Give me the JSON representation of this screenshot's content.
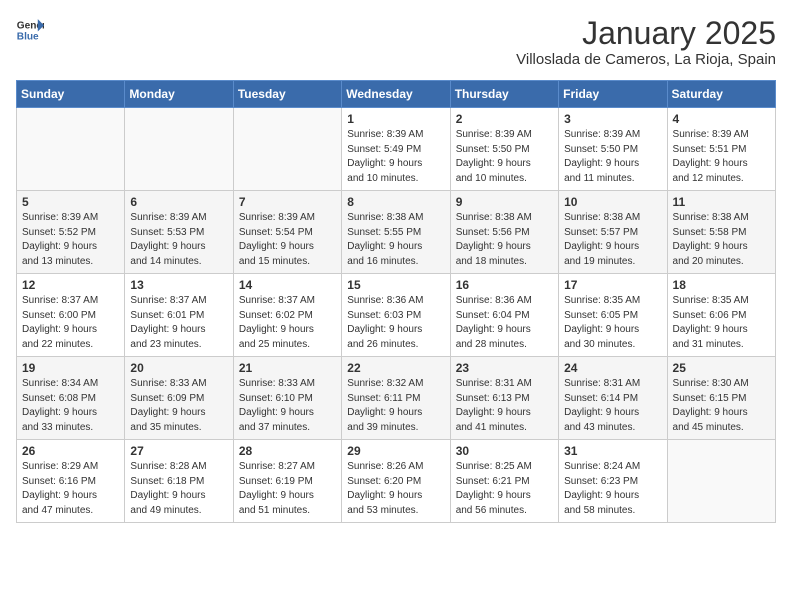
{
  "logo": {
    "general": "General",
    "blue": "Blue"
  },
  "header": {
    "month": "January 2025",
    "location": "Villoslada de Cameros, La Rioja, Spain"
  },
  "weekdays": [
    "Sunday",
    "Monday",
    "Tuesday",
    "Wednesday",
    "Thursday",
    "Friday",
    "Saturday"
  ],
  "weeks": [
    [
      {
        "day": "",
        "info": ""
      },
      {
        "day": "",
        "info": ""
      },
      {
        "day": "",
        "info": ""
      },
      {
        "day": "1",
        "info": "Sunrise: 8:39 AM\nSunset: 5:49 PM\nDaylight: 9 hours\nand 10 minutes."
      },
      {
        "day": "2",
        "info": "Sunrise: 8:39 AM\nSunset: 5:50 PM\nDaylight: 9 hours\nand 10 minutes."
      },
      {
        "day": "3",
        "info": "Sunrise: 8:39 AM\nSunset: 5:50 PM\nDaylight: 9 hours\nand 11 minutes."
      },
      {
        "day": "4",
        "info": "Sunrise: 8:39 AM\nSunset: 5:51 PM\nDaylight: 9 hours\nand 12 minutes."
      }
    ],
    [
      {
        "day": "5",
        "info": "Sunrise: 8:39 AM\nSunset: 5:52 PM\nDaylight: 9 hours\nand 13 minutes."
      },
      {
        "day": "6",
        "info": "Sunrise: 8:39 AM\nSunset: 5:53 PM\nDaylight: 9 hours\nand 14 minutes."
      },
      {
        "day": "7",
        "info": "Sunrise: 8:39 AM\nSunset: 5:54 PM\nDaylight: 9 hours\nand 15 minutes."
      },
      {
        "day": "8",
        "info": "Sunrise: 8:38 AM\nSunset: 5:55 PM\nDaylight: 9 hours\nand 16 minutes."
      },
      {
        "day": "9",
        "info": "Sunrise: 8:38 AM\nSunset: 5:56 PM\nDaylight: 9 hours\nand 18 minutes."
      },
      {
        "day": "10",
        "info": "Sunrise: 8:38 AM\nSunset: 5:57 PM\nDaylight: 9 hours\nand 19 minutes."
      },
      {
        "day": "11",
        "info": "Sunrise: 8:38 AM\nSunset: 5:58 PM\nDaylight: 9 hours\nand 20 minutes."
      }
    ],
    [
      {
        "day": "12",
        "info": "Sunrise: 8:37 AM\nSunset: 6:00 PM\nDaylight: 9 hours\nand 22 minutes."
      },
      {
        "day": "13",
        "info": "Sunrise: 8:37 AM\nSunset: 6:01 PM\nDaylight: 9 hours\nand 23 minutes."
      },
      {
        "day": "14",
        "info": "Sunrise: 8:37 AM\nSunset: 6:02 PM\nDaylight: 9 hours\nand 25 minutes."
      },
      {
        "day": "15",
        "info": "Sunrise: 8:36 AM\nSunset: 6:03 PM\nDaylight: 9 hours\nand 26 minutes."
      },
      {
        "day": "16",
        "info": "Sunrise: 8:36 AM\nSunset: 6:04 PM\nDaylight: 9 hours\nand 28 minutes."
      },
      {
        "day": "17",
        "info": "Sunrise: 8:35 AM\nSunset: 6:05 PM\nDaylight: 9 hours\nand 30 minutes."
      },
      {
        "day": "18",
        "info": "Sunrise: 8:35 AM\nSunset: 6:06 PM\nDaylight: 9 hours\nand 31 minutes."
      }
    ],
    [
      {
        "day": "19",
        "info": "Sunrise: 8:34 AM\nSunset: 6:08 PM\nDaylight: 9 hours\nand 33 minutes."
      },
      {
        "day": "20",
        "info": "Sunrise: 8:33 AM\nSunset: 6:09 PM\nDaylight: 9 hours\nand 35 minutes."
      },
      {
        "day": "21",
        "info": "Sunrise: 8:33 AM\nSunset: 6:10 PM\nDaylight: 9 hours\nand 37 minutes."
      },
      {
        "day": "22",
        "info": "Sunrise: 8:32 AM\nSunset: 6:11 PM\nDaylight: 9 hours\nand 39 minutes."
      },
      {
        "day": "23",
        "info": "Sunrise: 8:31 AM\nSunset: 6:13 PM\nDaylight: 9 hours\nand 41 minutes."
      },
      {
        "day": "24",
        "info": "Sunrise: 8:31 AM\nSunset: 6:14 PM\nDaylight: 9 hours\nand 43 minutes."
      },
      {
        "day": "25",
        "info": "Sunrise: 8:30 AM\nSunset: 6:15 PM\nDaylight: 9 hours\nand 45 minutes."
      }
    ],
    [
      {
        "day": "26",
        "info": "Sunrise: 8:29 AM\nSunset: 6:16 PM\nDaylight: 9 hours\nand 47 minutes."
      },
      {
        "day": "27",
        "info": "Sunrise: 8:28 AM\nSunset: 6:18 PM\nDaylight: 9 hours\nand 49 minutes."
      },
      {
        "day": "28",
        "info": "Sunrise: 8:27 AM\nSunset: 6:19 PM\nDaylight: 9 hours\nand 51 minutes."
      },
      {
        "day": "29",
        "info": "Sunrise: 8:26 AM\nSunset: 6:20 PM\nDaylight: 9 hours\nand 53 minutes."
      },
      {
        "day": "30",
        "info": "Sunrise: 8:25 AM\nSunset: 6:21 PM\nDaylight: 9 hours\nand 56 minutes."
      },
      {
        "day": "31",
        "info": "Sunrise: 8:24 AM\nSunset: 6:23 PM\nDaylight: 9 hours\nand 58 minutes."
      },
      {
        "day": "",
        "info": ""
      }
    ]
  ]
}
